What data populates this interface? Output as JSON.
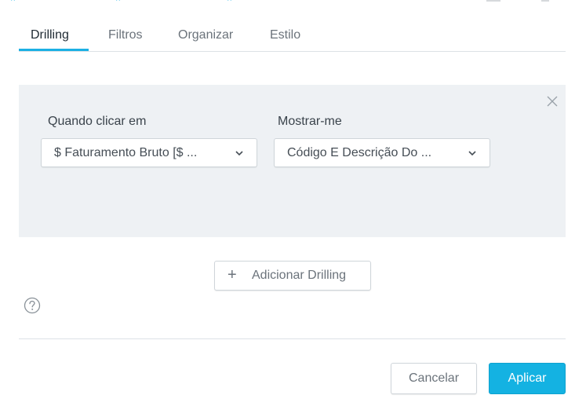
{
  "tabs": [
    {
      "label": "Drilling",
      "active": true
    },
    {
      "label": "Filtros",
      "active": false
    },
    {
      "label": "Organizar",
      "active": false
    },
    {
      "label": "Estilo",
      "active": false
    }
  ],
  "drill_rule": {
    "when_click_label": "Quando clicar em",
    "when_click_value": "$ Faturamento Bruto [$ ...",
    "show_me_label": "Mostrar-me",
    "show_me_value": "Código E Descrição Do ..."
  },
  "add_drilling_label": "Adicionar Drilling",
  "footer": {
    "cancel_label": "Cancelar",
    "apply_label": "Aplicar"
  },
  "colors": {
    "accent": "#14b2e2",
    "panel_bg": "#eef1f4",
    "border": "#cfd5da"
  },
  "icons": [
    "close-icon",
    "chevron-down-icon",
    "plus-icon",
    "help-icon"
  ]
}
